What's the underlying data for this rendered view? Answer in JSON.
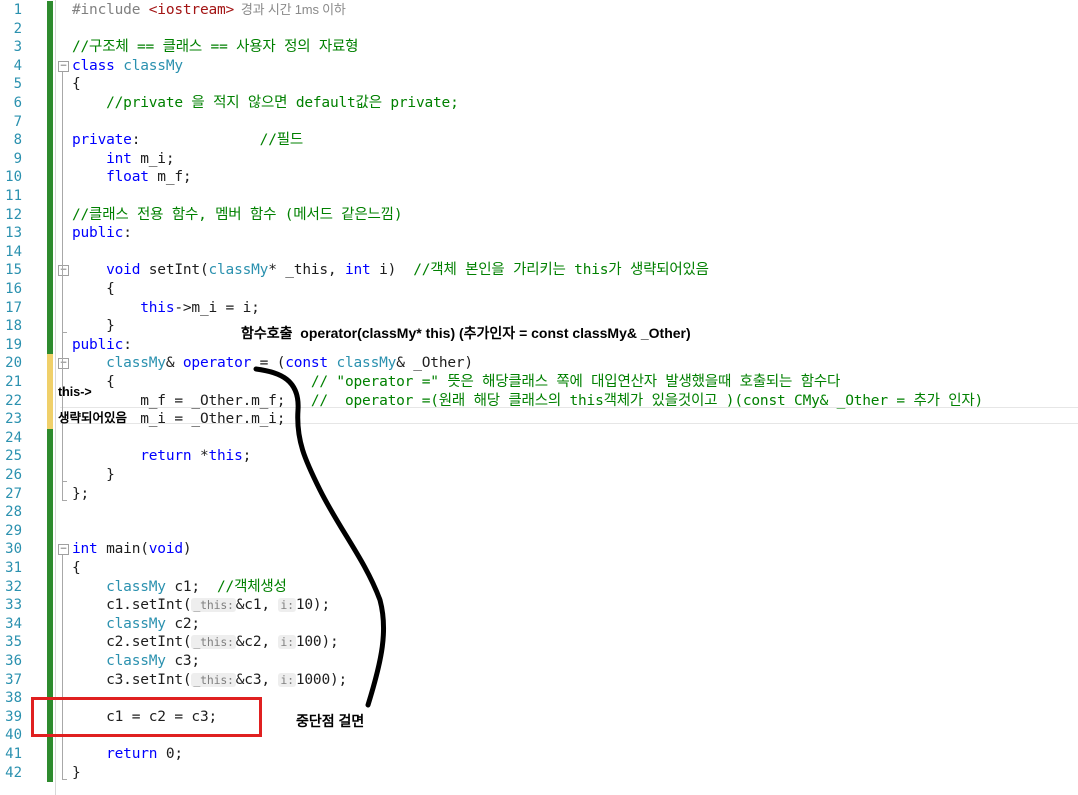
{
  "editor": {
    "lines": [
      {
        "n": "1",
        "t": [
          [
            "pp",
            "#include "
          ],
          [
            "str",
            "<iostream>"
          ],
          [
            "hint2",
            "  경과 시간 1ms 이하"
          ]
        ]
      },
      {
        "n": "2",
        "t": []
      },
      {
        "n": "3",
        "t": [
          [
            "cm",
            "//구조체 == 클래스 == 사용자 정의 자료형"
          ]
        ]
      },
      {
        "n": "4",
        "t": [
          [
            "kw",
            "class "
          ],
          [
            "ty",
            "classMy"
          ]
        ]
      },
      {
        "n": "5",
        "t": [
          [
            "tx",
            "{"
          ]
        ]
      },
      {
        "n": "6",
        "t": [
          [
            "cm",
            "    //private 을 적지 않으면 default값은 private;"
          ]
        ]
      },
      {
        "n": "7",
        "t": []
      },
      {
        "n": "8",
        "t": [
          [
            "kw",
            "private"
          ],
          [
            "tx",
            ":              "
          ],
          [
            "cm",
            "//필드"
          ]
        ]
      },
      {
        "n": "9",
        "t": [
          [
            "tx",
            "    "
          ],
          [
            "kw",
            "int"
          ],
          [
            "tx",
            " m_i;"
          ]
        ]
      },
      {
        "n": "10",
        "t": [
          [
            "tx",
            "    "
          ],
          [
            "kw",
            "float"
          ],
          [
            "tx",
            " m_f;"
          ]
        ]
      },
      {
        "n": "11",
        "t": []
      },
      {
        "n": "12",
        "t": [
          [
            "cm",
            "//클래스 전용 함수, 멤버 함수 (메서드 같은느낌)"
          ]
        ]
      },
      {
        "n": "13",
        "t": [
          [
            "kw",
            "public"
          ],
          [
            "tx",
            ":"
          ]
        ]
      },
      {
        "n": "14",
        "t": []
      },
      {
        "n": "15",
        "t": [
          [
            "tx",
            "    "
          ],
          [
            "kw",
            "void"
          ],
          [
            "tx",
            " setInt("
          ],
          [
            "ty",
            "classMy"
          ],
          [
            "tx",
            "* _this, "
          ],
          [
            "kw",
            "int"
          ],
          [
            "tx",
            " i)  "
          ],
          [
            "cm",
            "//객체 본인을 가리키는 this가 생략되어있음"
          ]
        ]
      },
      {
        "n": "16",
        "t": [
          [
            "tx",
            "    {"
          ]
        ]
      },
      {
        "n": "17",
        "t": [
          [
            "tx",
            "        "
          ],
          [
            "kw",
            "this"
          ],
          [
            "tx",
            "->m_i = i;"
          ]
        ]
      },
      {
        "n": "18",
        "t": [
          [
            "tx",
            "    }"
          ]
        ]
      },
      {
        "n": "19",
        "t": [
          [
            "kw",
            "public"
          ],
          [
            "tx",
            ":"
          ]
        ]
      },
      {
        "n": "20",
        "t": [
          [
            "tx",
            "    "
          ],
          [
            "ty",
            "classMy"
          ],
          [
            "tx",
            "& "
          ],
          [
            "kw",
            "operator"
          ],
          [
            "tx",
            " = ("
          ],
          [
            "kw",
            "const "
          ],
          [
            "ty",
            "classMy"
          ],
          [
            "tx",
            "& _Other)"
          ]
        ]
      },
      {
        "n": "21",
        "t": [
          [
            "tx",
            "    {                       "
          ],
          [
            "cm",
            "// \"operator =\" 뜻은 해당클래스 쪽에 대입연산자 발생했을때 호출되는 함수다"
          ]
        ]
      },
      {
        "n": "22",
        "t": [
          [
            "tx",
            "        m_f = _Other.m_f;   "
          ],
          [
            "cm",
            "//  operator =(원래 해당 클래스의 this객체가 있을것이고 )(const CMy& _Other = 추가 인자)"
          ]
        ]
      },
      {
        "n": "23",
        "t": [
          [
            "tx",
            "        m_i = _Other.m_i;"
          ]
        ]
      },
      {
        "n": "24",
        "t": []
      },
      {
        "n": "25",
        "t": [
          [
            "tx",
            "        "
          ],
          [
            "kw",
            "return"
          ],
          [
            "tx",
            " *"
          ],
          [
            "kw",
            "this"
          ],
          [
            "tx",
            ";"
          ]
        ]
      },
      {
        "n": "26",
        "t": [
          [
            "tx",
            "    }"
          ]
        ]
      },
      {
        "n": "27",
        "t": [
          [
            "tx",
            "};"
          ]
        ]
      },
      {
        "n": "28",
        "t": []
      },
      {
        "n": "29",
        "t": []
      },
      {
        "n": "30",
        "t": [
          [
            "kw",
            "int"
          ],
          [
            "tx",
            " main("
          ],
          [
            "kw",
            "void"
          ],
          [
            "tx",
            ")"
          ]
        ]
      },
      {
        "n": "31",
        "t": [
          [
            "tx",
            "{"
          ]
        ]
      },
      {
        "n": "32",
        "t": [
          [
            "tx",
            "    "
          ],
          [
            "ty",
            "classMy"
          ],
          [
            "tx",
            " c1;  "
          ],
          [
            "cm",
            "//객체생성"
          ]
        ]
      },
      {
        "n": "33",
        "t": [
          [
            "tx",
            "    c1.setInt("
          ],
          [
            "hint",
            "_this:"
          ],
          [
            "tx",
            "&c1, "
          ],
          [
            "hint",
            "i:"
          ],
          [
            "tx",
            "10);"
          ]
        ]
      },
      {
        "n": "34",
        "t": [
          [
            "tx",
            "    "
          ],
          [
            "ty",
            "classMy"
          ],
          [
            "tx",
            " c2;"
          ]
        ]
      },
      {
        "n": "35",
        "t": [
          [
            "tx",
            "    c2.setInt("
          ],
          [
            "hint",
            "_this:"
          ],
          [
            "tx",
            "&c2, "
          ],
          [
            "hint",
            "i:"
          ],
          [
            "tx",
            "100);"
          ]
        ]
      },
      {
        "n": "36",
        "t": [
          [
            "tx",
            "    "
          ],
          [
            "ty",
            "classMy"
          ],
          [
            "tx",
            " c3;"
          ]
        ]
      },
      {
        "n": "37",
        "t": [
          [
            "tx",
            "    c3.setInt("
          ],
          [
            "hint",
            "_this:"
          ],
          [
            "tx",
            "&c3, "
          ],
          [
            "hint",
            "i:"
          ],
          [
            "tx",
            "1000);"
          ]
        ]
      },
      {
        "n": "38",
        "t": []
      },
      {
        "n": "39",
        "t": [
          [
            "tx",
            "    c1 = c2 = c3;"
          ]
        ]
      },
      {
        "n": "40",
        "t": []
      },
      {
        "n": "41",
        "t": [
          [
            "tx",
            "    "
          ],
          [
            "kw",
            "return"
          ],
          [
            "tx",
            " 0;"
          ]
        ]
      },
      {
        "n": "42",
        "t": [
          [
            "tx",
            "}"
          ]
        ]
      }
    ]
  },
  "annotations": {
    "call_note": "함수호출  operator(classMy* this) (추가인자 = const classMy& _Other)",
    "this_arrow": "this->",
    "omitted_note": "생략되어있음",
    "breakpoint_note": "중단점 걸면"
  },
  "colors": {
    "keyword": "#0000ff",
    "type": "#2b91af",
    "comment": "#008000",
    "preprocessor": "#808080",
    "string": "#a31515",
    "change_bar": "#2e8b2e",
    "highlight_box": "#e02020"
  }
}
